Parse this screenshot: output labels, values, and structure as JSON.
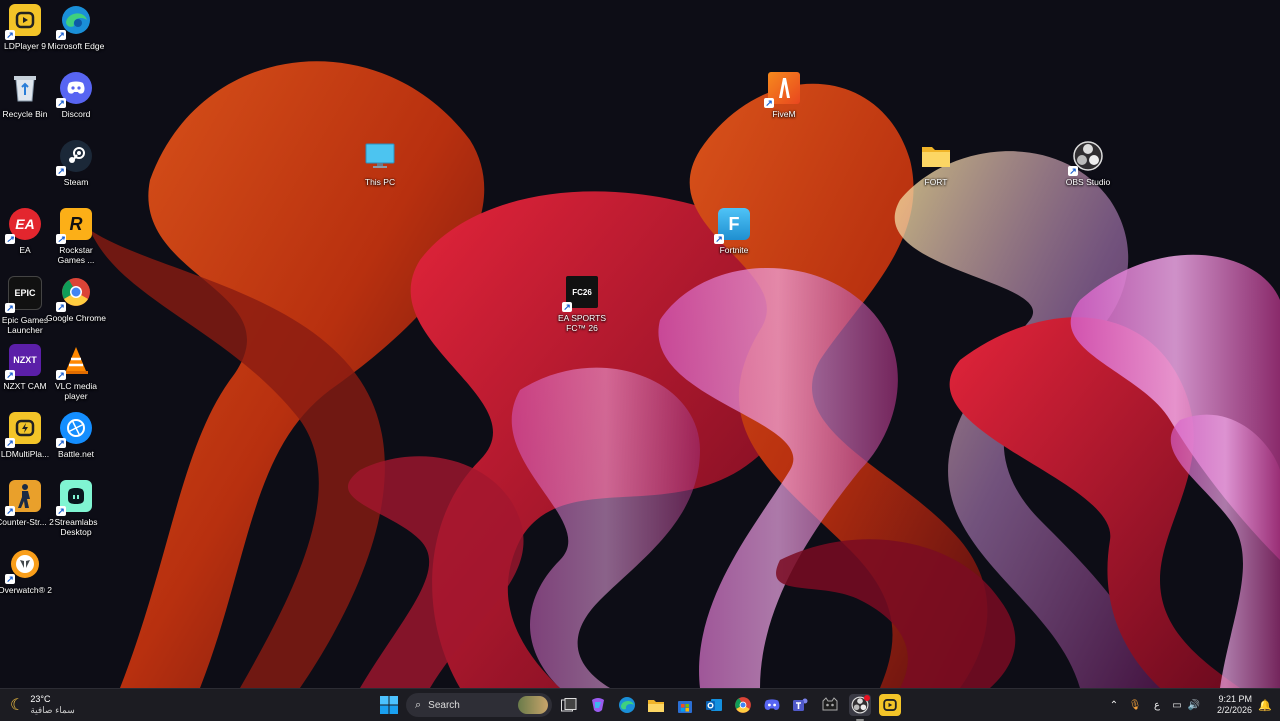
{
  "desktop": {
    "icons": {
      "ldplayer9": "LDPlayer 9",
      "edge": "Microsoft Edge",
      "recycle_bin": "Recycle Bin",
      "discord": "Discord",
      "steam": "Steam",
      "this_pc": "This PC",
      "ea": "EA",
      "rockstar": "Rockstar Games ...",
      "epic": "Epic Games Launcher",
      "chrome": "Google Chrome",
      "nzxt": "NZXT CAM",
      "vlc": "VLC media player",
      "ldmulti": "LDMultiPla...",
      "battlenet": "Battle.net",
      "counterstrike": "Counter-Str... 2",
      "streamlabs": "Streamlabs Desktop",
      "overwatch": "Overwatch® 2",
      "eafc": "EA SPORTS FC™ 26",
      "fivem": "FiveM",
      "fortnite": "Fortnite",
      "fort_folder": "FORT",
      "obs": "OBS Studio"
    },
    "glyphs": {
      "ea": "EA",
      "epic": "EPIC",
      "nzxt": "NZXT",
      "fortnite": "F",
      "rockstar": "R",
      "eafc": "FC26"
    }
  },
  "taskbar": {
    "weather_temp": "23°C",
    "weather_desc": "سماء صافية",
    "search_placeholder": "Search",
    "language": "ع",
    "time": "9:21 PM",
    "date": "2/2/2026"
  },
  "colors": {
    "taskbar_bg": "#1c1c22",
    "accent": "#0078d4"
  }
}
